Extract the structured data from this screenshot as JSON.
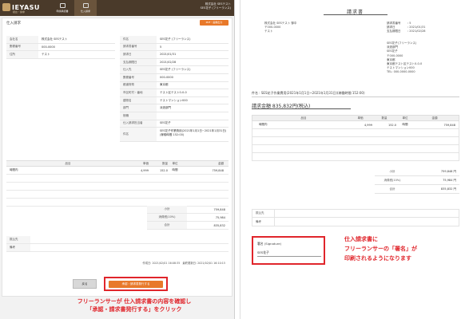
{
  "app": {
    "logo": "IEYASU",
    "logo_sub": "勤怠・請求",
    "nav": [
      {
        "label": "申請承認書"
      },
      {
        "label": "仕入請求"
      }
    ],
    "user_company": "株式会社 SESテスト",
    "user_name": "SES花子 (フリーランス)"
  },
  "panel": {
    "title": "仕入請求",
    "pdf_button": "PDF・画像出力",
    "left_fields": [
      {
        "k": "会社名",
        "v": "株式会社 SESテスト"
      },
      {
        "k": "郵便番号",
        "v": "000-0000"
      },
      {
        "k": "住所",
        "v": "テスト"
      }
    ],
    "right_fields": [
      {
        "k": "件名",
        "v": "SES花子 (フリーランス)"
      },
      {
        "k": "請求書番号",
        "v": "5"
      },
      {
        "k": "請求日",
        "v": "2021/01/31"
      },
      {
        "k": "支払期限日",
        "v": "2021/02/28"
      },
      {
        "k": "仕入先",
        "v": "SES花子 (フリーランス)"
      },
      {
        "k": "郵便番号",
        "v": "000-0000"
      },
      {
        "k": "都道府県",
        "v": "東京都"
      },
      {
        "k": "市区町村・番地",
        "v": "テスト区テスト0-0-0"
      },
      {
        "k": "建物名",
        "v": "テストマンション000"
      },
      {
        "k": "部門",
        "v": "派遣部門"
      },
      {
        "k": "役職",
        "v": ""
      },
      {
        "k": "仕入請求担当者",
        "v": "SES花子"
      },
      {
        "k": "件名",
        "v": "SES花子作業費用(2021年1月1日~2021年1月31日)(稼働時間 152:00)"
      }
    ],
    "items_header": [
      "品目",
      "単価",
      "数量",
      "単位",
      "金額"
    ],
    "items": [
      {
        "name": "時間内",
        "price": "4,999",
        "qty": "152.0",
        "unit": "時間",
        "amount": "759,848"
      },
      {
        "name": "",
        "price": "",
        "qty": "",
        "unit": "",
        "amount": ""
      },
      {
        "name": "",
        "price": "",
        "qty": "",
        "unit": "",
        "amount": ""
      },
      {
        "name": "",
        "price": "",
        "qty": "",
        "unit": "",
        "amount": ""
      },
      {
        "name": "",
        "price": "",
        "qty": "",
        "unit": "",
        "amount": ""
      }
    ],
    "totals": [
      {
        "k": "小計",
        "v": "759,848"
      },
      {
        "k": "消費税(10%)",
        "v": "75,984"
      },
      {
        "k": "合計",
        "v": "835,832"
      }
    ],
    "notes": [
      {
        "k": "振込先",
        "v": ""
      },
      {
        "k": "備考",
        "v": ""
      }
    ],
    "created": "作成日: 2021/02/01 16:08:35",
    "updated": "最終更新日: 2021/02/01 16:10:15",
    "back_button": "戻る",
    "approve_button": "承認・請求書発行する"
  },
  "annotation_left": [
    "フリーランサーが 仕入請求書の内容を確認し",
    "「承認・請求書発行する」をクリック"
  ],
  "doc": {
    "title": "請求書",
    "to": [
      "株式会社 SESテスト 御中",
      "〒000-0000",
      "テスト"
    ],
    "meta": [
      {
        "k": "請求書番号",
        "v": ": 5"
      },
      {
        "k": "請求日",
        "v": ": 2021/01/31"
      },
      {
        "k": "支払期限日",
        "v": ": 2021/02/28"
      }
    ],
    "from": [
      "SES花子(フリーランス)",
      "派遣部門",
      "SES花子",
      "〒000-0000",
      "東京都",
      "東京都テスト区テスト0-0-0",
      "テストマンション000",
      "TEL: 000-0000-0000"
    ],
    "subject": "件名 : SES花子作業費用(2021年1月1日~2021年1月31日)(稼働時間 152:00)",
    "amount": "請求金額 835,832円(税込)",
    "items_header": [
      "品目",
      "単価",
      "数量",
      "単位",
      "金額"
    ],
    "items": [
      {
        "name": "時間内",
        "price": "4,999",
        "qty": "152.0",
        "unit": "時間",
        "amount": "759,848"
      },
      {
        "name": "",
        "price": "",
        "qty": "",
        "unit": "",
        "amount": ""
      },
      {
        "name": "",
        "price": "",
        "qty": "",
        "unit": "",
        "amount": ""
      },
      {
        "name": "",
        "price": "",
        "qty": "",
        "unit": "",
        "amount": ""
      },
      {
        "name": "",
        "price": "",
        "qty": "",
        "unit": "",
        "amount": ""
      }
    ],
    "totals": [
      {
        "k": "小計",
        "v": "759,848 円"
      },
      {
        "k": "消費税(10%)",
        "v": "75,984 円"
      },
      {
        "k": "合計",
        "v": "835,832 円"
      }
    ],
    "notes": [
      {
        "k": "振込先",
        "v": ""
      },
      {
        "k": "備考",
        "v": ""
      }
    ],
    "signature_label": "署名 (Signature)",
    "signature_name": "SES花子"
  },
  "annotation_right": [
    "仕入請求書に",
    "フリーランサーの「署名」が",
    "印刷されるようになります"
  ]
}
